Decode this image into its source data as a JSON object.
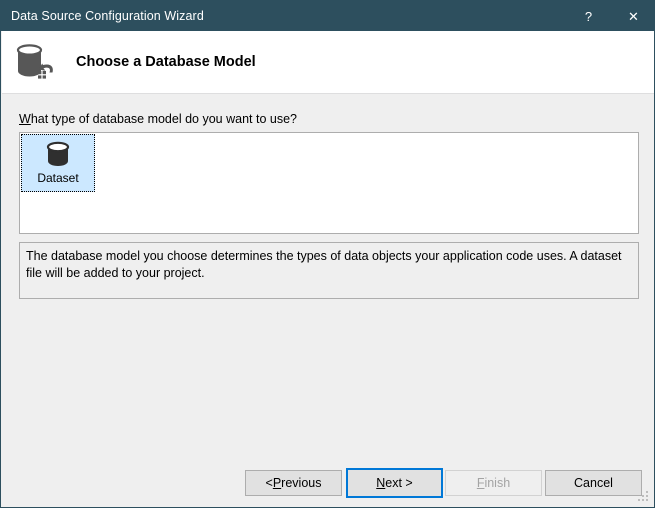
{
  "window": {
    "title": "Data Source Configuration Wizard",
    "titlebar_bg": "#2D4F5E",
    "body_bg": "#EFEFEF",
    "accent": "#0078D7",
    "selection_bg": "#CCE8FF"
  },
  "titlebar_buttons": [
    {
      "name": "help-button",
      "glyph": "?"
    },
    {
      "name": "close-button",
      "glyph": "✕"
    }
  ],
  "header": {
    "icon": "database-connection-icon",
    "title": "Choose a Database Model"
  },
  "main": {
    "prompt_prefix": "",
    "prompt_accel": "W",
    "prompt_rest": "hat type of database model do you want to use?",
    "prompt_full": "What type of database model do you want to use?",
    "list": {
      "name": "database-model-list",
      "items": [
        {
          "label": "Dataset",
          "icon": "database-cylinder-icon",
          "selected": true
        }
      ]
    },
    "description": "The database model you choose determines the types of data objects your application code uses. A dataset file will be added to your project."
  },
  "footer": {
    "buttons": [
      {
        "name": "previous-button",
        "prefix": "< ",
        "accel": "P",
        "rest": "revious",
        "label": "< Previous",
        "state": "enabled",
        "default": false
      },
      {
        "name": "next-button",
        "prefix": "",
        "accel": "N",
        "rest": "ext >",
        "label": "Next >",
        "state": "enabled",
        "default": true
      },
      {
        "name": "finish-button",
        "prefix": "",
        "accel": "F",
        "rest": "inish",
        "label": "Finish",
        "state": "disabled",
        "default": false
      },
      {
        "name": "cancel-button",
        "prefix": "",
        "accel": "",
        "rest": "Cancel",
        "label": "Cancel",
        "state": "enabled",
        "default": false
      }
    ],
    "resize_grip": "resize-grip"
  }
}
